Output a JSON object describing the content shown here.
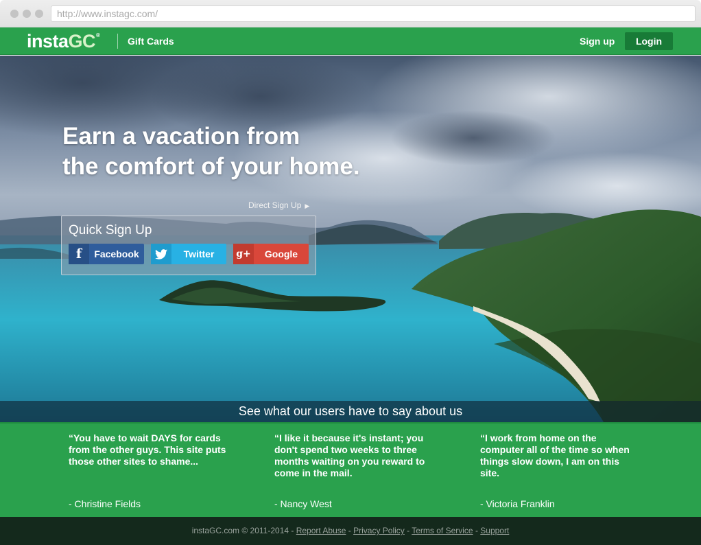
{
  "browser": {
    "url": "http://www.instagc.com/"
  },
  "header": {
    "logo_main": "insta",
    "logo_accent": "GC",
    "logo_mark": "®",
    "nav_gift_cards": "Gift Cards",
    "signup_label": "Sign up",
    "login_label": "Login"
  },
  "hero": {
    "title_line1": "Earn a vacation from",
    "title_line2": "the comfort of your home.",
    "direct_signup": "Direct Sign Up",
    "quick_signup_title": "Quick Sign Up",
    "buttons": [
      {
        "label": "Facebook",
        "icon": "facebook-icon",
        "color": "#2f5d9c"
      },
      {
        "label": "Twitter",
        "icon": "twitter-icon",
        "color": "#28b1e4"
      },
      {
        "label": "Google",
        "icon": "google-plus-icon",
        "color": "#d9473a"
      }
    ],
    "users_say": "See what our users have to say about us"
  },
  "testimonials": [
    {
      "quote": "“You have to wait DAYS for cards from the other guys. This site puts those other sites to shame...",
      "author": "- Christine Fields"
    },
    {
      "quote": "“I like it because it's instant; you don't spend two weeks to three months waiting on you reward to come in the mail.",
      "author": "- Nancy West"
    },
    {
      "quote": "“I work from home on the computer all of the time so when things slow down, I am on this site.",
      "author": "- Victoria Franklin"
    }
  ],
  "footer": {
    "copyright": "instaGC.com © 2011-2014",
    "separator": " - ",
    "links": [
      "Report Abuse",
      "Privacy Policy",
      "Terms of Service",
      "Support"
    ]
  },
  "colors": {
    "brand_green": "#2aa14d",
    "login_green": "#187b37",
    "footer_bg": "#14291c"
  }
}
